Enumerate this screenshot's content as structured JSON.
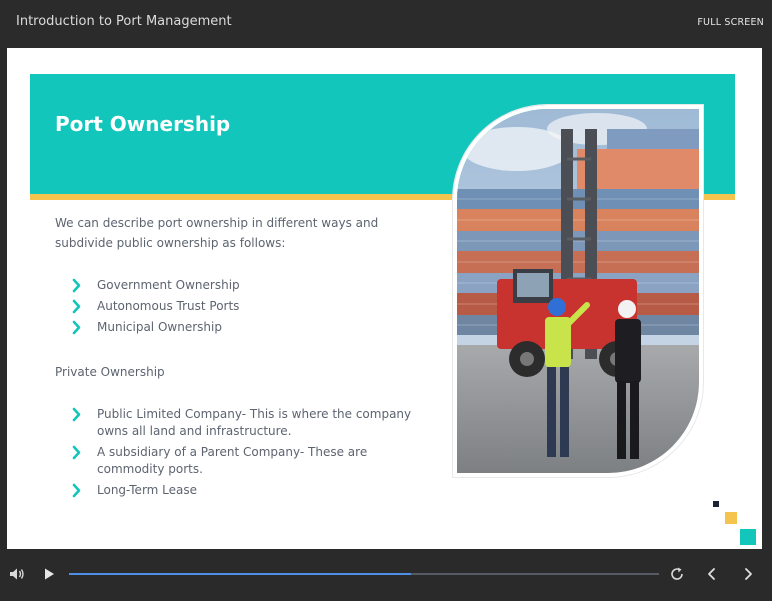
{
  "header": {
    "course_title": "Introduction to Port Management",
    "fullscreen_label": "FULL SCREEN"
  },
  "slide": {
    "title": "Port Ownership",
    "intro": "We can describe port ownership in different ways and subdivide public ownership as follows:",
    "public_items": [
      "Government Ownership",
      "Autonomous Trust Ports",
      "Municipal Ownership"
    ],
    "private_label": "Private Ownership",
    "private_items": [
      "Public Limited Company- This is where the company owns all land and infrastructure.",
      "A subsidiary of a Parent Company- These are commodity ports.",
      "Long-Term Lease"
    ],
    "colors": {
      "accent_teal": "#13c6bb",
      "accent_yellow": "#f4c44e",
      "dark_navy": "#1d2330"
    }
  },
  "player": {
    "progress_fraction": 0.58,
    "icons": [
      "volume-icon",
      "play-icon",
      "replay-icon",
      "previous-icon",
      "next-icon"
    ]
  }
}
